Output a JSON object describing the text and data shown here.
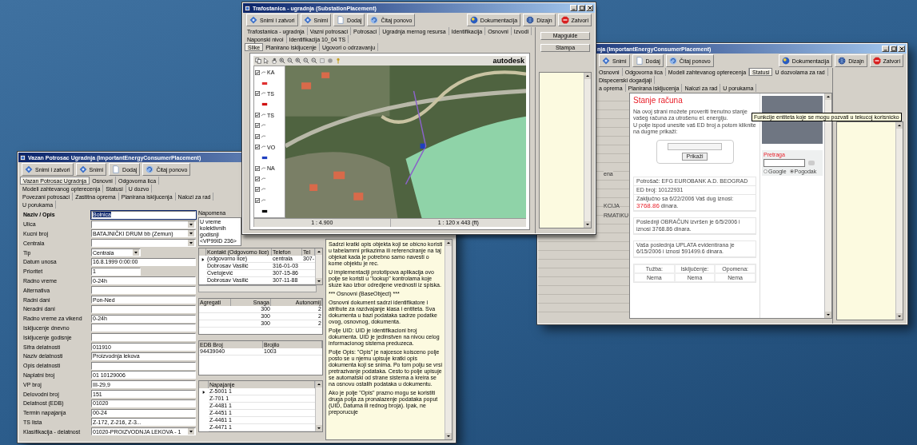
{
  "consumer_window": {
    "title": "Vazan Potrosac Ugradnja (ImportantEnergyConsumerPlacement)",
    "toolbar": [
      {
        "label": "Snimi i zatvori",
        "kind": "save"
      },
      {
        "label": "Snimi",
        "kind": "save"
      },
      {
        "label": "Dodaj",
        "kind": "page"
      },
      {
        "label": "Čitaj ponovo",
        "kind": "refresh"
      }
    ],
    "tabs": [
      [
        {
          "label": "Vazan Potrosac Ugradnja",
          "selected": true
        },
        {
          "label": "Osnovni",
          "selected": false
        },
        {
          "label": "Odgovorna lica",
          "selected": false
        },
        {
          "label": "Modeli zahtevanog opterecenja",
          "selected": false
        },
        {
          "label": "Statusi",
          "selected": false
        },
        {
          "label": "U dozvo",
          "selected": false
        }
      ],
      [
        {
          "label": "Povezani potrosaci",
          "selected": false
        },
        {
          "label": "Zastitna oprema",
          "selected": false
        },
        {
          "label": "Planirana iskljucenja",
          "selected": false
        },
        {
          "label": "Nalozi za rad",
          "selected": false
        },
        {
          "label": "U porukama",
          "selected": false
        }
      ]
    ],
    "fields": [
      {
        "label": "Naziv / Opis",
        "value": "Bolnica",
        "kind": "text",
        "focused": true
      },
      {
        "label": "Ulica",
        "kind": "dropdown",
        "focused": false
      },
      {
        "label": "Kucni broj",
        "value": "BATAJNIČKI DRUM bb (Zemun)",
        "kind": "dropdown",
        "focused": false
      },
      {
        "label": "Centrala",
        "kind": "dropdown",
        "focused": false
      },
      {
        "label": "Tip",
        "value": "Centrala",
        "kind": "short-dropdown",
        "focused": false
      },
      {
        "label": "Datum unosa",
        "value": "16.8.1999 0:00:00",
        "kind": "text",
        "focused": false
      },
      {
        "label": "Prioritet",
        "value": "1",
        "kind": "short-text",
        "focused": false
      },
      {
        "label": "Radno vreme",
        "value": "0-24h",
        "kind": "text",
        "focused": false
      },
      {
        "label": "Alternativa",
        "kind": "text",
        "focused": false
      },
      {
        "label": "Radni dani",
        "value": "Pon-Ned",
        "kind": "text",
        "focused": false
      },
      {
        "label": "Neradni dani",
        "kind": "text",
        "focused": false
      },
      {
        "label": "Radno vreme za vikend",
        "value": "0-24h",
        "kind": "text",
        "focused": false
      },
      {
        "label": "Iskljucenje dnevno",
        "kind": "text",
        "focused": false
      },
      {
        "label": "Iskljucenje godisnje",
        "kind": "text",
        "focused": false
      },
      {
        "label": "Sifra delatnosti",
        "value": "011910",
        "kind": "text",
        "focused": false
      },
      {
        "label": "Naziv delatnosti",
        "value": "Proizvodnja lekova",
        "kind": "text",
        "focused": false
      },
      {
        "label": "Opis delatnosti",
        "kind": "text",
        "focused": false
      },
      {
        "label": "Naplatni broj",
        "value": "01 10129006",
        "kind": "text",
        "focused": false
      },
      {
        "label": "VP broj",
        "value": "III-29,9",
        "kind": "text",
        "focused": false
      },
      {
        "label": "Delovodni broj",
        "value": "151",
        "kind": "text",
        "focused": false
      },
      {
        "label": "Delatnost (EDB)",
        "value": "01020",
        "kind": "text",
        "focused": false
      },
      {
        "label": "Termin napajanja",
        "value": "00-24",
        "kind": "text",
        "focused": false
      },
      {
        "label": "TS lista",
        "value": "Z-172, Z-216, Z-3...",
        "kind": "text",
        "focused": false
      },
      {
        "label": "Klasifikacija - delatnost",
        "value": "01020-PROIZVODNJA LEKOVA - 1",
        "kind": "dropdown",
        "focused": false
      }
    ],
    "note": {
      "label": "Napomena",
      "lines": [
        "U vreme kolektivnih godisnji",
        "<VP99ID 236>"
      ]
    },
    "contacts": {
      "columns": [
        "Kontakt (Odgovorno lice)",
        "Telefon",
        "Tel"
      ],
      "rows": [
        {
          "current": true,
          "cells": [
            "(odgovorno lice)",
            "centrala",
            "307-"
          ]
        },
        {
          "current": false,
          "cells": [
            "Dobrosav Vasilić",
            "316-01-03",
            null
          ]
        },
        {
          "current": false,
          "cells": [
            "Cvetojević",
            "307-15-86",
            null
          ]
        },
        {
          "current": false,
          "cells": [
            "Dobrosav Vasilić",
            "307-11-88",
            null
          ]
        }
      ]
    },
    "generators": {
      "columns": [
        "Agregati",
        "Snaga",
        "Autonomij"
      ],
      "rows": [
        {
          "cells": [
            null,
            "300",
            "2"
          ]
        },
        {
          "cells": [
            null,
            "300",
            "2"
          ]
        },
        {
          "cells": [
            null,
            "300",
            "2"
          ]
        }
      ]
    },
    "meters": {
      "columns": [
        "EDB Broj",
        "Brojilo"
      ],
      "rows": [
        {
          "cells": [
            "94439040",
            "1003"
          ]
        }
      ]
    },
    "supply": {
      "columns": [
        "Napajanje"
      ],
      "rows": [
        {
          "current": true,
          "cells": [
            "Z-5001 1"
          ]
        },
        {
          "current": false,
          "cells": [
            "Z-701 1"
          ]
        },
        {
          "current": false,
          "cells": [
            "Z-4481 1"
          ]
        },
        {
          "current": false,
          "cells": [
            "Z-4451 1"
          ]
        },
        {
          "current": false,
          "cells": [
            "Z-4461 1"
          ]
        },
        {
          "current": false,
          "cells": [
            "Z-4471 1"
          ]
        }
      ]
    },
    "help_text": [
      "Sadrzi kratki opis objekta koji se obicno koristi u tabelamrni prikazima ili referenciranje na taj objekat kada je potrebno samo navesti o kome objektu je rec.",
      "U implementaciji prototipova aplikacija ovo polje se koristi u \"lookup\" kontrolama koje sluze kao izbor odredjene vrednosti iz spiska.",
      "*** Osnovni (BaseObject) ***",
      "Osnovni dokument sadrzi identifikatore i atribute za razdvajanje klasa i entiteta. Sva dokumenta u bazi podataka sadrze podatke ovog, osnovnog, dokumenta.",
      "Polje UID: UID je identifikacioni broj dokumenta. UID je jedinstven na nivou celog informacionog sistema preduzeca.",
      "Polje Opis: \"Opis\" je najcesce koisceno polje posto se u njemu upisuje kratki opis dokumenta koji se snima. Po tom polju se vrsi pretrazivanje podataka. Cesto to polje upisuje se automatski od strane sistema a kreira se na osnovu ostalih podataka u dokumentu.",
      "Ako je polje \"Opis\" prazno mogu se koristiti druga polja za pronalazenje podataka poput (UID, Datuma ili rednog broja). Ipak, ne preporucuje"
    ]
  },
  "account_window": {
    "title": "nja (ImportantEnergyConsumerPlacement)",
    "toolbar": [
      {
        "label": "Snimi",
        "kind": "save"
      },
      {
        "label": "Dodaj",
        "kind": "page"
      },
      {
        "label": "Čitaj ponovo",
        "kind": "refresh"
      }
    ],
    "toolbar_right": [
      {
        "label": "Dokumentacija",
        "kind": "info"
      },
      {
        "label": "Dizajn",
        "kind": "globe"
      },
      {
        "label": "Zatvori",
        "kind": "stop"
      }
    ],
    "tabs": [
      [
        {
          "label": "Osnovni",
          "selected": false
        },
        {
          "label": "Odgovorna lica",
          "selected": false
        },
        {
          "label": "Modeli zahtevanog opterecenja",
          "selected": false
        },
        {
          "label": "Statusi",
          "selected": true
        },
        {
          "label": "U dozvolama za rad",
          "selected": false
        },
        {
          "label": "Dispecerski dogadjaji",
          "selected": false
        }
      ],
      [
        {
          "label": "a oprema",
          "selected": false
        },
        {
          "label": "Planirana iskljucenja",
          "selected": false
        },
        {
          "label": "Nalozi za rad",
          "selected": false
        },
        {
          "label": "U porukama",
          "selected": false
        }
      ]
    ],
    "side_fragments": [
      "ena",
      "KCIJA",
      "RMATIKU"
    ],
    "page": {
      "heading": "Stanje računa",
      "intro": [
        "Na ovoj strani možete proveriti trenutno stanje vašeg računa za utrošenu el. energiju.",
        "U polje ispod unesite vaš ED broj a potom kliknite na dugme prikaži:"
      ],
      "show_button": "Prikaži",
      "consumer": "Potrošač:  EFG EUROBANK A.D. BEOGRAD",
      "ed_number": "ED broj:   10122931",
      "debt": {
        "text": "Zaključno sa  6/22/2006  Vaš dug iznosi:",
        "amount": "3768.86",
        "unit": "dinara."
      },
      "last_bill": "Poslednji OBRAČUN izvršen je 6/5/2006 i iznosi 3768.86 dinara.",
      "last_payment": "Vaša poslednja UPLATA evidentirana je 6/15/2006 i iznosi 591499.6 dinara.",
      "status": {
        "columns": [
          "Tužba:",
          "Isključenje:",
          "Opomena:"
        ],
        "values": [
          "Nema",
          "Nema",
          "Nema"
        ]
      },
      "search": {
        "label": "Pretraga",
        "options": [
          {
            "label": "Google",
            "selected": false
          },
          {
            "label": "Pogodak",
            "selected": true
          }
        ]
      }
    },
    "tooltip": "Funkcije entiteta koje se mogu pozvati u tekucoj korisnicko"
  },
  "substation_window": {
    "title": "Trafostanica - ugradnja (SubstationPlacement)",
    "toolbar": [
      {
        "label": "Snimi i zatvori",
        "kind": "save"
      },
      {
        "label": "Snimi",
        "kind": "save"
      },
      {
        "label": "Dodaj",
        "kind": "page"
      },
      {
        "label": "Čitaj ponovo",
        "kind": "refresh"
      }
    ],
    "toolbar_right": [
      {
        "label": "Dokumentacija",
        "kind": "info"
      },
      {
        "label": "Dizajn",
        "kind": "globe"
      },
      {
        "label": "Zatvori",
        "kind": "stop"
      }
    ],
    "tabs": [
      [
        {
          "label": "Trafostanica - ugradnja",
          "selected": false
        },
        {
          "label": "Vazni potrosaci",
          "selected": false
        },
        {
          "label": "Potrosaci",
          "selected": false
        },
        {
          "label": "Ugradnja mernog resursa",
          "selected": false
        },
        {
          "label": "Identifikacija",
          "selected": false
        },
        {
          "label": "Osnovni",
          "selected": false
        },
        {
          "label": "Izvodi",
          "selected": false
        },
        {
          "label": "Naponski nivoi",
          "selected": false
        },
        {
          "label": "Identifikacija 10_04 TS",
          "selected": false
        }
      ],
      [
        {
          "label": "Slike",
          "selected": true
        },
        {
          "label": "Planirano iskljucenje",
          "selected": false
        },
        {
          "label": "Ugovori o odrzavanju",
          "selected": false
        }
      ]
    ],
    "side_buttons": [
      "Mapguide",
      "Stampa"
    ],
    "map": {
      "logo": "autodesk",
      "layers": [
        {
          "kind": "layer",
          "checked": true,
          "label": "KA"
        },
        {
          "kind": "legend",
          "color": "#e03030"
        },
        {
          "kind": "layer",
          "checked": true,
          "label": "TS"
        },
        {
          "kind": "legend",
          "color": "#d01010"
        },
        {
          "kind": "layer",
          "checked": true,
          "label": "TS"
        },
        {
          "kind": "layer",
          "checked": true
        },
        {
          "kind": "layer",
          "checked": true
        },
        {
          "kind": "layer",
          "checked": true,
          "label": "VO"
        },
        {
          "kind": "legend",
          "color": "#2040c0"
        },
        {
          "kind": "layer",
          "checked": true,
          "label": "NA"
        },
        {
          "kind": "layer",
          "checked": true
        },
        {
          "kind": "layer",
          "checked": true
        },
        {
          "kind": "layer",
          "checked": true
        },
        {
          "kind": "legend",
          "color": "#000000"
        }
      ],
      "scale": "1 : 4.900",
      "extent": "1 : 120 x 443 (ft)"
    }
  }
}
